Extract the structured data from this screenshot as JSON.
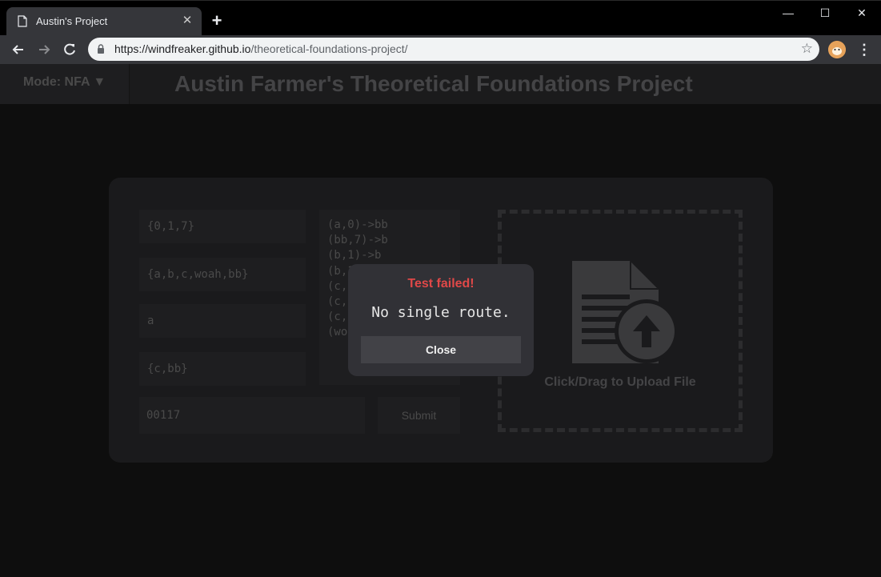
{
  "browser": {
    "tab_title": "Austin's Project",
    "tab_close": "✕",
    "new_tab": "+",
    "url_host": "https://windfreaker.github.io",
    "url_path": "/theoretical-foundations-project/",
    "window_minimize": "—",
    "window_maximize": "☐",
    "window_close": "✕",
    "menu": "⋮",
    "star": "☆"
  },
  "header": {
    "mode_label": "Mode: NFA ▼",
    "title": "Austin Farmer's Theoretical Foundations Project"
  },
  "form": {
    "alphabet": "{0,1,7}",
    "states": "{a,b,c,woah,bb}",
    "start_state": "a",
    "accept_states": "{c,bb}",
    "transitions": "(a,0)->bb\n(bb,7)->b\n(b,1)->b\n(b,1)->c\n(c,0)->c\n(c,1)->woah\n(c,7)->a\n(woah,0)->a",
    "input_string": "00117",
    "submit_label": "Submit"
  },
  "upload": {
    "label": "Click/Drag to Upload File"
  },
  "modal": {
    "title": "Test failed!",
    "message": "No single route.",
    "close_label": "Close"
  },
  "colors": {
    "error": "#e04848",
    "modal_bg": "#313136",
    "page_bg": "#0e0e0e"
  }
}
